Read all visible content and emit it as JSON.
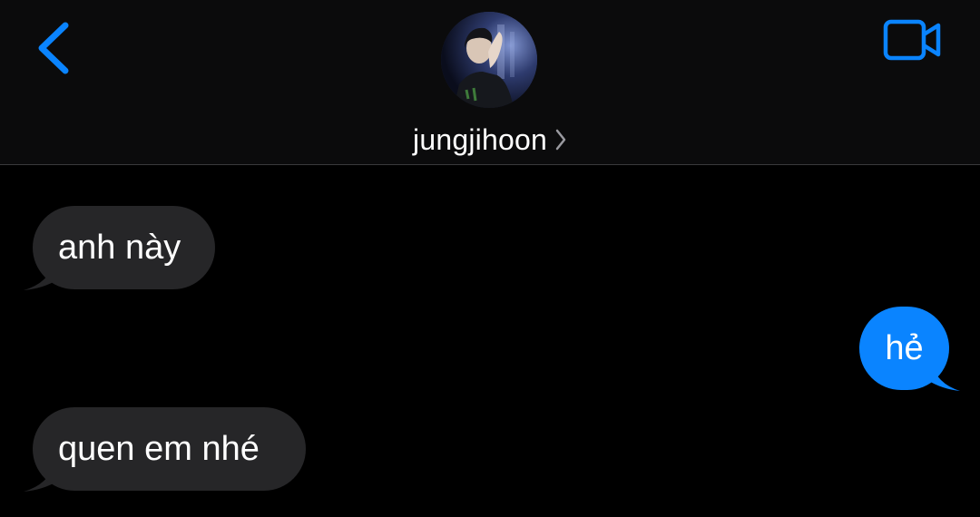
{
  "header": {
    "contact_name": "jungjihoon",
    "back_icon": "chevron-left-icon",
    "video_icon": "video-camera-icon",
    "name_chevron_icon": "chevron-right-icon",
    "accent_color": "#0a84ff"
  },
  "messages": [
    {
      "direction": "incoming",
      "text": "anh này"
    },
    {
      "direction": "outgoing",
      "text": "hẻ"
    },
    {
      "direction": "incoming",
      "text": "quen em nhé"
    }
  ],
  "colors": {
    "background": "#000000",
    "incoming_bubble": "#262628",
    "outgoing_bubble": "#0a84ff",
    "text": "#ffffff"
  }
}
